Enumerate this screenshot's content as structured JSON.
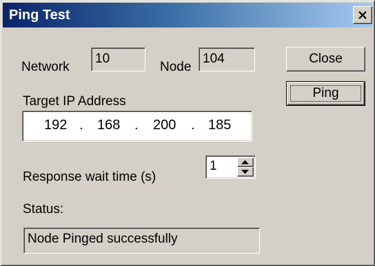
{
  "window": {
    "title": "Ping Test"
  },
  "network": {
    "label": "Network",
    "value": "10"
  },
  "node": {
    "label": "Node",
    "value": "104"
  },
  "buttons": {
    "close": "Close",
    "ping": "Ping"
  },
  "target": {
    "label": "Target IP Address",
    "octets": [
      "192",
      "168",
      "200",
      "185"
    ],
    "separator": "."
  },
  "response": {
    "label": "Response wait time (s)",
    "value": "1"
  },
  "status": {
    "label": "Status:",
    "value": "Node Pinged successfully"
  }
}
